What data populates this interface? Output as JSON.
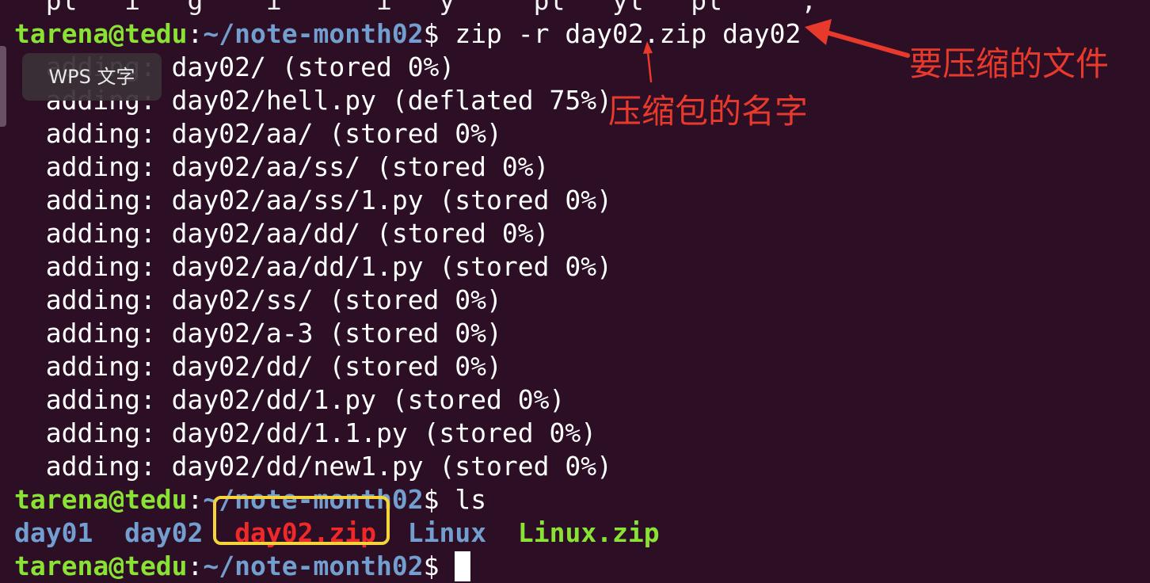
{
  "terminal": {
    "lines": [
      {
        "type": "output",
        "text": "  pl   i   g    i      i   y     pl   yl   pl     ,"
      },
      {
        "type": "prompt",
        "user": "tarena@tedu",
        "sep": ":",
        "path": "~/note-month02",
        "symbol": "$",
        "command": " zip -r day02.zip day02"
      },
      {
        "type": "output",
        "text": "  adding: day02/ (stored 0%)"
      },
      {
        "type": "output",
        "text": "  adding: day02/hell.py (deflated 75%)"
      },
      {
        "type": "output",
        "text": "  adding: day02/aa/ (stored 0%)"
      },
      {
        "type": "output",
        "text": "  adding: day02/aa/ss/ (stored 0%)"
      },
      {
        "type": "output",
        "text": "  adding: day02/aa/ss/1.py (stored 0%)"
      },
      {
        "type": "output",
        "text": "  adding: day02/aa/dd/ (stored 0%)"
      },
      {
        "type": "output",
        "text": "  adding: day02/aa/dd/1.py (stored 0%)"
      },
      {
        "type": "output",
        "text": "  adding: day02/ss/ (stored 0%)"
      },
      {
        "type": "output",
        "text": "  adding: day02/a-3 (stored 0%)"
      },
      {
        "type": "output",
        "text": "  adding: day02/dd/ (stored 0%)"
      },
      {
        "type": "output",
        "text": "  adding: day02/dd/1.py (stored 0%)"
      },
      {
        "type": "output",
        "text": "  adding: day02/dd/1.1.py (stored 0%)"
      },
      {
        "type": "output",
        "text": "  adding: day02/dd/new1.py (stored 0%)"
      },
      {
        "type": "prompt",
        "user": "tarena@tedu",
        "sep": ":",
        "path": "~/note-month02",
        "symbol": "$",
        "command": " ls"
      },
      {
        "type": "ls",
        "items": [
          {
            "name": "day01",
            "kind": "dir"
          },
          {
            "name": "day02",
            "kind": "dir"
          },
          {
            "name": "day02.zip",
            "kind": "zip"
          },
          {
            "name": "Linux",
            "kind": "dir"
          },
          {
            "name": "Linux.zip",
            "kind": "zip2"
          }
        ]
      },
      {
        "type": "prompt-cursor",
        "user": "tarena@tedu",
        "sep": ":",
        "path": "~/note-month02",
        "symbol": "$"
      }
    ]
  },
  "tooltip": {
    "text": "WPS 文字"
  },
  "annotations": {
    "file_to_compress": "要压缩的文件",
    "archive_name": "压缩包的名字"
  },
  "colors": {
    "background": "#2c0e25",
    "user": "#8ae234",
    "path": "#729fcf",
    "zip_red": "#ef2929",
    "annotation_red": "#e73a2c",
    "highlight_yellow": "#f5d43b"
  }
}
